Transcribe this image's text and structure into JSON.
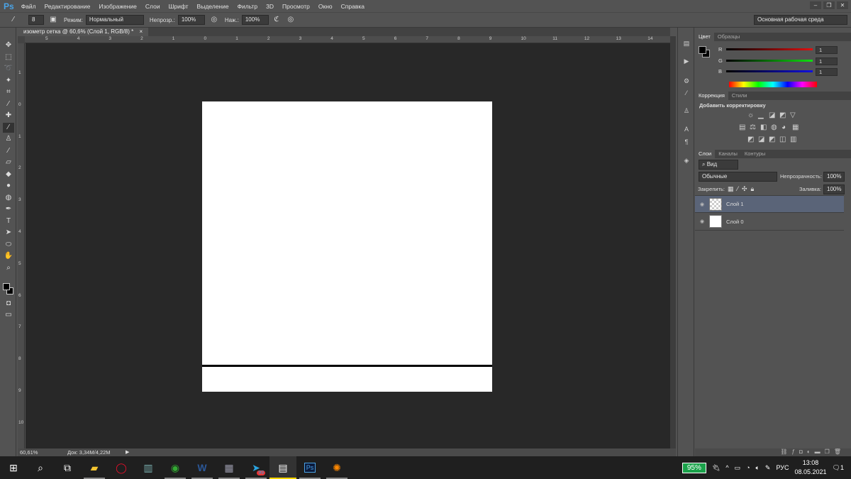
{
  "app": {
    "logo": "Ps",
    "menu": [
      "Файл",
      "Редактирование",
      "Изображение",
      "Слои",
      "Шрифт",
      "Выделение",
      "Фильтр",
      "3D",
      "Просмотр",
      "Окно",
      "Справка"
    ],
    "workspace": "Основная рабочая среда"
  },
  "options": {
    "brush_size": "8",
    "mode_label": "Режим:",
    "mode_value": "Нормальный",
    "opacity_label": "Непрозр.:",
    "opacity_value": "100%",
    "flow_label": "Наж.:",
    "flow_value": "100%"
  },
  "document": {
    "tab_title": "изометр сетка @ 60,6% (Слой 1, RGB/8) *",
    "close": "×",
    "ruler_top": [
      "5",
      "4",
      "3",
      "2",
      "1",
      "0",
      "1",
      "2",
      "3",
      "4",
      "5",
      "6",
      "7",
      "8",
      "9",
      "10",
      "11",
      "12",
      "13",
      "14"
    ],
    "ruler_left": [
      "1",
      "0",
      "1",
      "2",
      "3",
      "4",
      "5",
      "6",
      "7",
      "8",
      "9",
      "10"
    ]
  },
  "status": {
    "zoom": "60,61%",
    "doc": "Док: 3,34M/4,22M"
  },
  "color_panel": {
    "tabs": [
      "Цвет",
      "Образцы"
    ],
    "channels": [
      {
        "label": "R",
        "value": "1",
        "color": "#e01010"
      },
      {
        "label": "G",
        "value": "1",
        "color": "#10e010"
      },
      {
        "label": "B",
        "value": "1",
        "color": "#1010e0"
      }
    ]
  },
  "adjust_panel": {
    "tabs": [
      "Коррекция",
      "Стили"
    ],
    "title": "Добавить корректировку"
  },
  "layers_panel": {
    "tabs": [
      "Слои",
      "Каналы",
      "Контуры"
    ],
    "filter": "Вид",
    "blend": "Обычные",
    "opacity_label": "Непрозрачность:",
    "opacity_value": "100%",
    "lock_label": "Закрепить:",
    "fill_label": "Заливка:",
    "fill_value": "100%",
    "layers": [
      {
        "name": "Слой 1",
        "selected": true
      },
      {
        "name": "Слой 0",
        "selected": false
      }
    ]
  },
  "taskbar": {
    "battery": "95%",
    "lang": "РУС",
    "time": "13:08",
    "date": "08.05.2021",
    "telegram_badge": "99",
    "notif": "1"
  }
}
